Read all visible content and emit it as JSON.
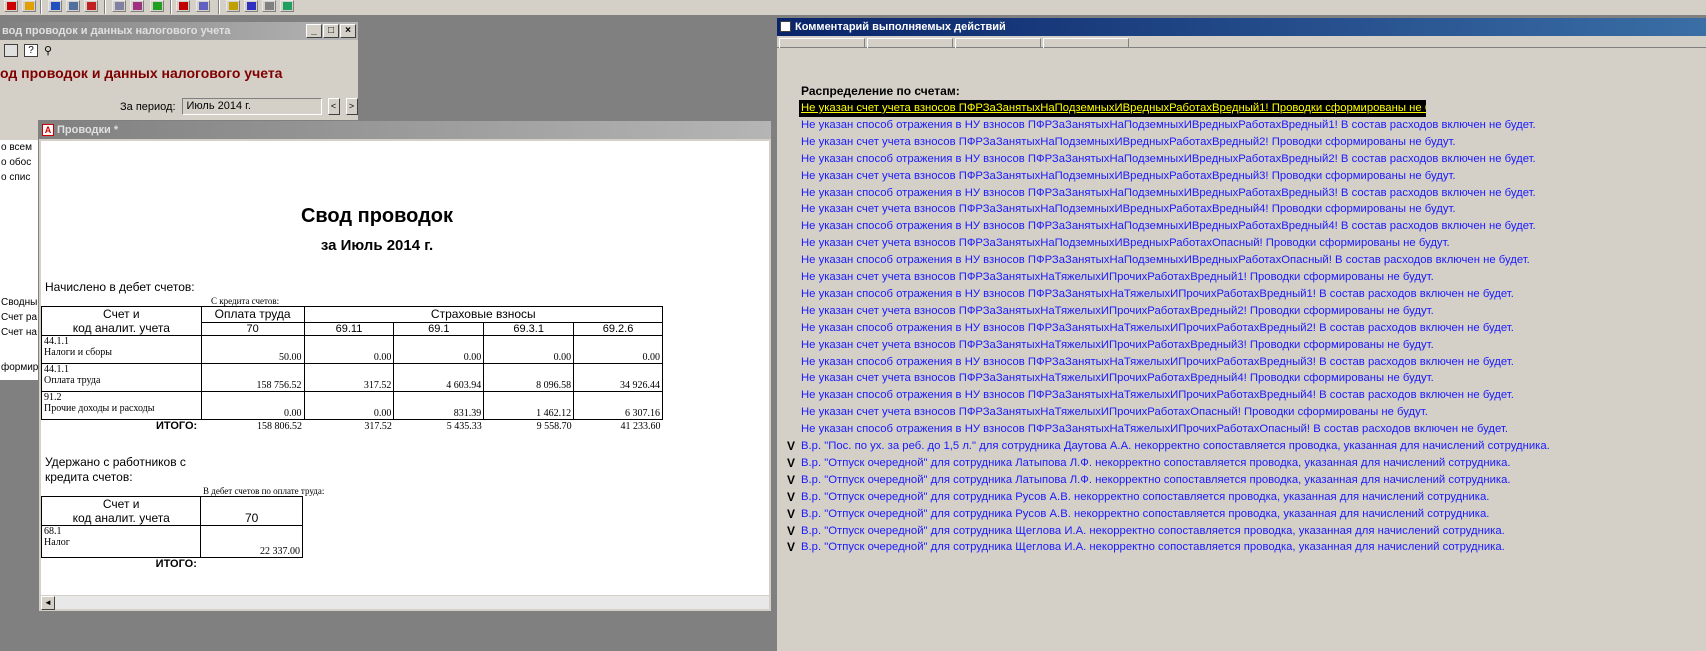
{
  "toolbar": {
    "icons": [
      "doc-icon",
      "chart-icon",
      "table-icon",
      "copy-icon",
      "report-icon",
      "calc-icon",
      "book-icon",
      "run-icon",
      "edit-icon",
      "tree-icon",
      "lamp-icon",
      "help-icon",
      "settings-icon"
    ]
  },
  "left_window": {
    "title": "вод проводок и данных налогового учета",
    "heading": "од проводок и данных налогового учета",
    "period_label": "За период:",
    "period_value": "Июль 2014 г.",
    "list_items": [
      "о всем",
      "о обос",
      "о спис",
      "Сводны",
      "Счет ра",
      "Счет на",
      "формиров"
    ]
  },
  "provodki_window": {
    "title": "Проводки",
    "modified_mark": "*",
    "report": {
      "title": "Свод проводок",
      "subtitle": "за Июль 2014 г.",
      "section1": "Начислено в дебет счетов:",
      "credit_caption": "С кредита счетов:",
      "col_account": "Счет и",
      "col_account2": "код аналит. учета",
      "col_salary": "Оплата труда",
      "col_insurance": "Страховые взносы",
      "sub_70": "70",
      "sub_cols": [
        "69.11",
        "69.1",
        "69.3.1",
        "69.2.6"
      ],
      "rows": [
        {
          "acc": "44.1.1",
          "name": "Налоги и сборы",
          "v": [
            "50.00",
            "0.00",
            "0.00",
            "0.00",
            "0.00"
          ]
        },
        {
          "acc": "44.1.1",
          "name": "Оплата труда",
          "v": [
            "158 756.52",
            "317.52",
            "4 603.94",
            "8 096.58",
            "34 926.44"
          ]
        },
        {
          "acc": "91.2",
          "name": "Прочие доходы и расходы",
          "v": [
            "0.00",
            "0.00",
            "831.39",
            "1 462.12",
            "6 307.16"
          ]
        }
      ],
      "total_label": "ИТОГО:",
      "totals": [
        "158 806.52",
        "317.52",
        "5 435.33",
        "9 558.70",
        "41 233.60"
      ],
      "section2_line1": "Удержано с работников с",
      "section2_line2": "кредита счетов:",
      "debit_caption": "В дебет счетов по оплате труда:",
      "t2_col_account": "Счет и",
      "t2_col_account2": "код аналит. учета",
      "t2_col_70": "70",
      "t2_acc": "68.1",
      "t2_name": "Налог",
      "t2_value": "22 337.00",
      "t2_total_label": "ИТОГО:"
    }
  },
  "comment_window": {
    "title": "Комментарий выполняемых действий",
    "header": "Распределение по счетам:",
    "messages": [
      "Не указан счет учета взносов ПФРЗаЗанятыхНаПодземныхИВредныхРаботахВредный1! Проводки сформированы не будут.",
      "Не указан способ отражения в НУ взносов ПФРЗаЗанятыхНаПодземныхИВредныхРаботахВредный1! В состав расходов включен не будет.",
      "Не указан счет учета взносов ПФРЗаЗанятыхНаПодземныхИВредныхРаботахВредный2! Проводки сформированы не будут.",
      "Не указан способ отражения в НУ взносов ПФРЗаЗанятыхНаПодземныхИВредныхРаботахВредный2! В состав расходов включен не будет.",
      "Не указан счет учета взносов ПФРЗаЗанятыхНаПодземныхИВредныхРаботахВредный3! Проводки сформированы не будут.",
      "Не указан способ отражения в НУ взносов ПФРЗаЗанятыхНаПодземныхИВредныхРаботахВредный3! В состав расходов включен не будет.",
      "Не указан счет учета взносов ПФРЗаЗанятыхНаПодземныхИВредныхРаботахВредный4! Проводки сформированы не будут.",
      "Не указан способ отражения в НУ взносов ПФРЗаЗанятыхНаПодземныхИВредныхРаботахВредный4! В состав расходов включен не будет.",
      "Не указан счет учета взносов ПФРЗаЗанятыхНаПодземныхИВредныхРаботахОпасный! Проводки сформированы не будут.",
      "Не указан способ отражения в НУ взносов ПФРЗаЗанятыхНаПодземныхИВредныхРаботахОпасный! В состав расходов включен не будет.",
      "Не указан счет учета взносов ПФРЗаЗанятыхНаТяжелыхИПрочихРаботахВредный1! Проводки сформированы не будут.",
      "Не указан способ отражения в НУ взносов ПФРЗаЗанятыхНаТяжелыхИПрочихРаботахВредный1! В состав расходов включен не будет.",
      "Не указан счет учета взносов ПФРЗаЗанятыхНаТяжелыхИПрочихРаботахВредный2! Проводки сформированы не будут.",
      "Не указан способ отражения в НУ взносов ПФРЗаЗанятыхНаТяжелыхИПрочихРаботахВредный2! В состав расходов включен не будет.",
      "Не указан счет учета взносов ПФРЗаЗанятыхНаТяжелыхИПрочихРаботахВредный3! Проводки сформированы не будут.",
      "Не указан способ отражения в НУ взносов ПФРЗаЗанятыхНаТяжелыхИПрочихРаботахВредный3! В состав расходов включен не будет.",
      "Не указан счет учета взносов ПФРЗаЗанятыхНаТяжелыхИПрочихРаботахВредный4! Проводки сформированы не будут.",
      "Не указан способ отражения в НУ взносов ПФРЗаЗанятыхНаТяжелыхИПрочихРаботахВредный4! В состав расходов включен не будет.",
      "Не указан счет учета взносов ПФРЗаЗанятыхНаТяжелыхИПрочихРаботахОпасный! Проводки сформированы не будут.",
      "Не указан способ отражения в НУ взносов ПФРЗаЗанятыхНаТяжелыхИПрочихРаботахОпасный! В состав расходов включен не будет.",
      "В.р. \"Пос. по ух. за реб. до 1,5 л.\" для сотрудника Даутова А.А. некорректно сопоставляется проводка, указанная для начислений сотрудника.",
      "В.р. \"Отпуск очередной\" для сотрудника Латыпова Л.Ф. некорректно сопоставляется проводка, указанная для начислений сотрудника.",
      "В.р. \"Отпуск очередной\" для сотрудника Латыпова Л.Ф. некорректно сопоставляется проводка, указанная для начислений сотрудника.",
      "В.р. \"Отпуск очередной\" для сотрудника Русов А.В. некорректно сопоставляется проводка, указанная для начислений сотрудника.",
      "В.р. \"Отпуск очередной\" для сотрудника Русов А.В. некорректно сопоставляется проводка, указанная для начислений сотрудника.",
      "В.р. \"Отпуск очередной\" для сотрудника Щеглова И.А. некорректно сопоставляется проводка, указанная для начислений сотрудника.",
      "В.р. \"Отпуск очередной\" для сотрудника Щеглова И.А. некорректно сопоставляется проводка, указанная для начислений сотрудника."
    ],
    "mark": "V"
  }
}
